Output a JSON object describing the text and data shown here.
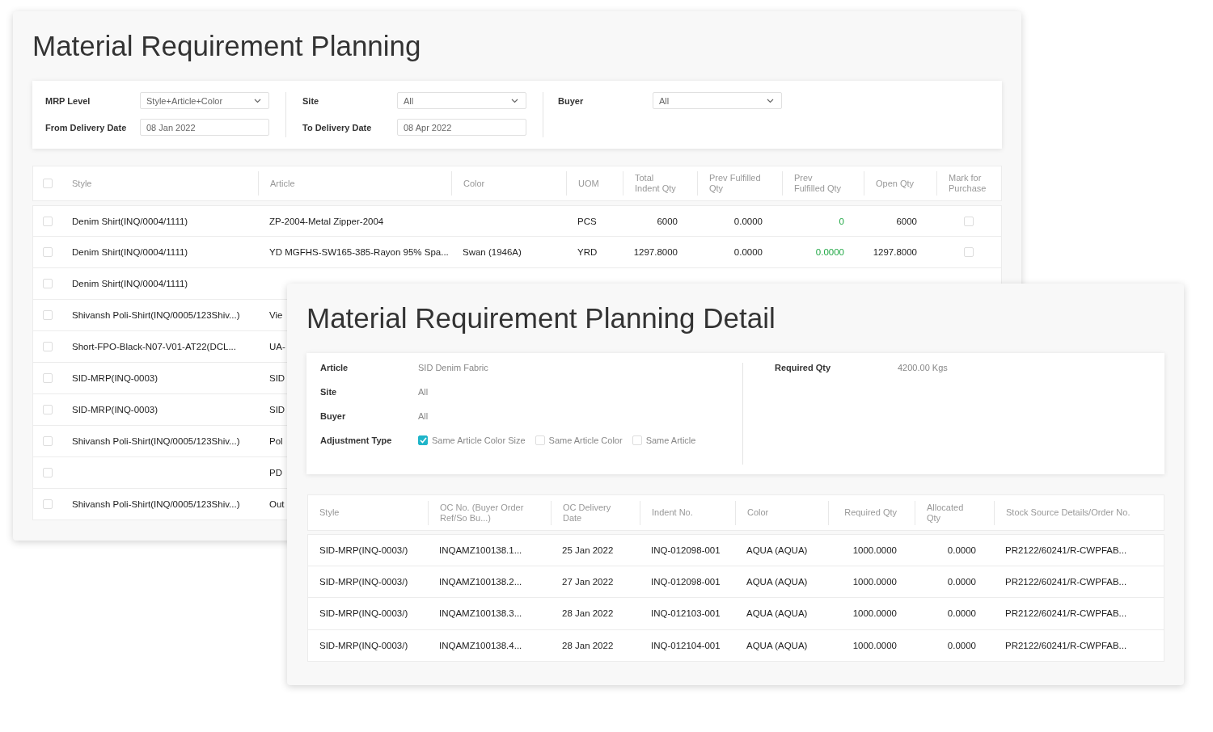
{
  "main_window": {
    "title": "Material Requirement Planning",
    "filter_groups": [
      [
        {
          "label": "MRP Level",
          "value": "Style+Article+Color",
          "kind": "select"
        },
        {
          "label": "From Delivery Date",
          "value": "08 Jan 2022",
          "kind": "date"
        }
      ],
      [
        {
          "label": "Site",
          "value": "All",
          "kind": "select"
        },
        {
          "label": "To Delivery Date",
          "value": "08 Apr 2022",
          "kind": "date"
        }
      ],
      [
        {
          "label": "Buyer",
          "value": "All",
          "kind": "select"
        }
      ]
    ],
    "table": {
      "select_all": false,
      "columns": [
        "Style",
        "Article",
        "Color",
        "UOM",
        "Total Indent Qty",
        "Prev Fulfilled Qty",
        "Prev Fulfilled Qty",
        "Open Qty",
        "Mark for Purchase"
      ],
      "rows": [
        {
          "selected": false,
          "cells": [
            "Denim Shirt(INQ/0004/1111)",
            "ZP-2004-Metal Zipper-2004",
            "",
            "PCS",
            "6000",
            "0.0000",
            "0",
            "6000"
          ],
          "marked": false
        },
        {
          "selected": false,
          "cells": [
            "Denim Shirt(INQ/0004/1111)",
            "YD MGFHS-SW165-385-Rayon 95% Spa...",
            "Swan (1946A)",
            "YRD",
            "1297.8000",
            "0.0000",
            "0.0000",
            "1297.8000"
          ],
          "marked": false
        },
        {
          "selected": false,
          "cells": [
            "Denim Shirt(INQ/0004/1111)"
          ]
        },
        {
          "selected": false,
          "cells": [
            "Shivansh Poli-Shirt(INQ/0005/123Shiv...)",
            "Vie"
          ]
        },
        {
          "selected": false,
          "cells": [
            "Short-FPO-Black-N07-V01-AT22(DCL...",
            "UA-"
          ]
        },
        {
          "selected": false,
          "cells": [
            "SID-MRP(INQ-0003)",
            "SID"
          ]
        },
        {
          "selected": false,
          "cells": [
            "SID-MRP(INQ-0003)",
            "SID"
          ]
        },
        {
          "selected": false,
          "cells": [
            "Shivansh Poli-Shirt(INQ/0005/123Shiv...)",
            "Pol"
          ]
        },
        {
          "selected": false,
          "cells": [
            "",
            "PD"
          ]
        },
        {
          "selected": false,
          "cells": [
            "Shivansh Poli-Shirt(INQ/0005/123Shiv...)",
            "Out"
          ]
        }
      ]
    }
  },
  "detail_window": {
    "title": "Material Requirement Planning Detail",
    "fields": [
      {
        "label": "Article",
        "value": "SID Denim Fabric"
      },
      {
        "label": "Site",
        "value": "All"
      },
      {
        "label": "Buyer",
        "value": "All"
      }
    ],
    "adjustment": {
      "label": "Adjustment Type",
      "options": [
        {
          "label": "Same Article Color Size",
          "checked": true
        },
        {
          "label": "Same Article Color",
          "checked": false
        },
        {
          "label": "Same Article",
          "checked": false
        }
      ]
    },
    "required": {
      "label": "Required Qty",
      "value": "4200.00 Kgs"
    },
    "table": {
      "columns": [
        "Style",
        "OC No. (Buyer Order Ref/So Bu...)",
        "OC Delivery Date",
        "Indent No.",
        "Color",
        "Required Qty",
        "Allocated Qty",
        "Stock Source Details/Order No."
      ],
      "rows": [
        [
          "SID-MRP(INQ-0003/)",
          "INQAMZ100138.1...",
          "25 Jan 2022",
          "INQ-012098-001",
          "AQUA (AQUA)",
          "1000.0000",
          "0.0000",
          "PR2122/60241/R-CWPFAB..."
        ],
        [
          "SID-MRP(INQ-0003/)",
          "INQAMZ100138.2...",
          "27 Jan 2022",
          "INQ-012098-001",
          "AQUA (AQUA)",
          "1000.0000",
          "0.0000",
          "PR2122/60241/R-CWPFAB..."
        ],
        [
          "SID-MRP(INQ-0003/)",
          "INQAMZ100138.3...",
          "28 Jan 2022",
          "INQ-012103-001",
          "AQUA (AQUA)",
          "1000.0000",
          "0.0000",
          "PR2122/60241/R-CWPFAB..."
        ],
        [
          "SID-MRP(INQ-0003/)",
          "INQAMZ100138.4...",
          "28 Jan 2022",
          "INQ-012104-001",
          "AQUA (AQUA)",
          "1000.0000",
          "0.0000",
          "PR2122/60241/R-CWPFAB..."
        ]
      ]
    }
  }
}
